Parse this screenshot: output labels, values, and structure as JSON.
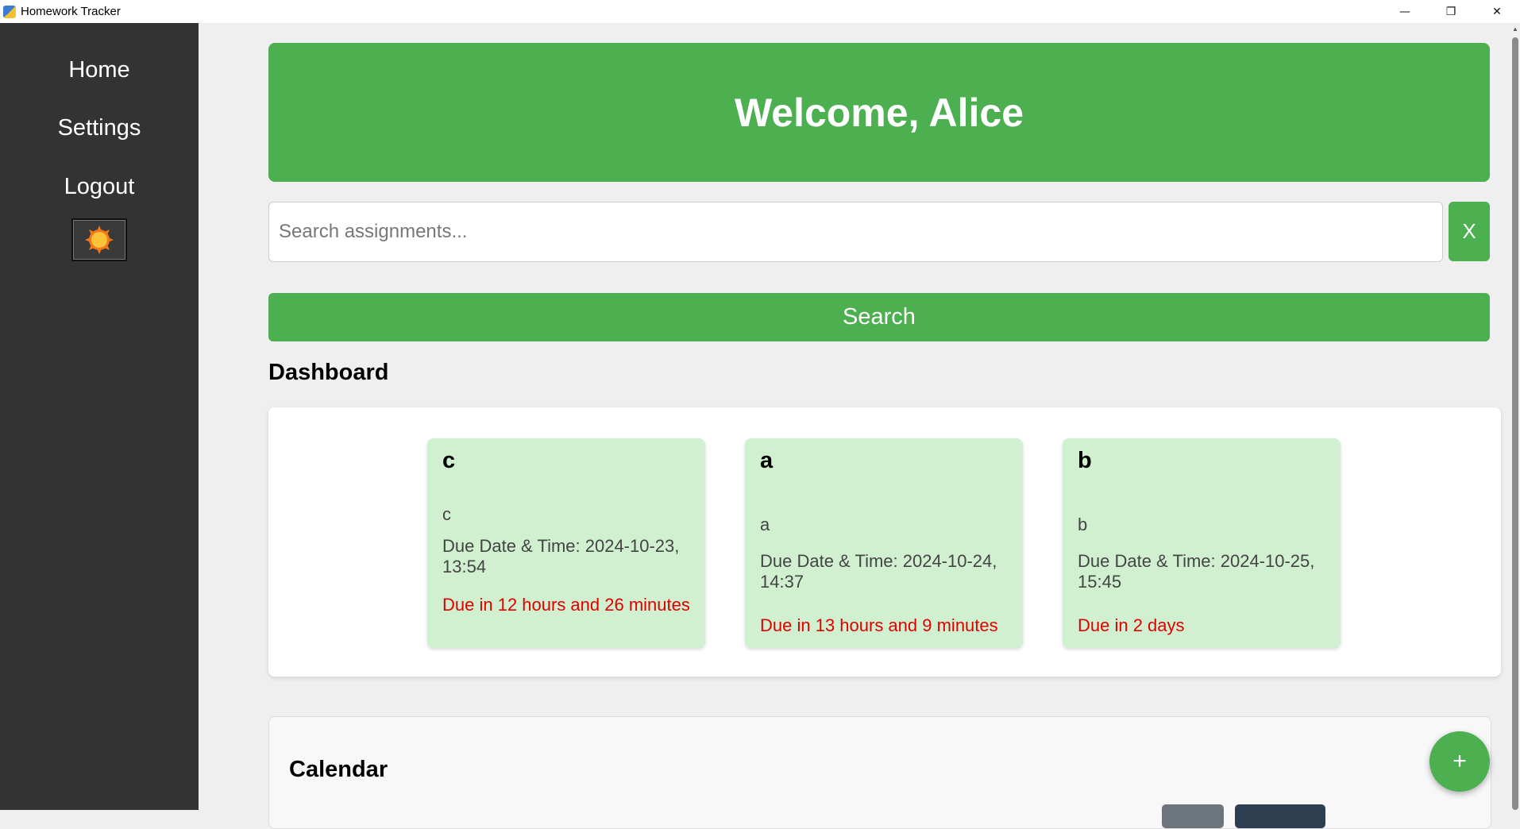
{
  "window": {
    "title": "Homework Tracker",
    "minimize_glyph": "—",
    "maximize_glyph": "❐",
    "close_glyph": "✕"
  },
  "sidebar": {
    "items": [
      {
        "label": "Home"
      },
      {
        "label": "Settings"
      },
      {
        "label": "Logout"
      }
    ],
    "theme_toggle_icon": "sun-icon"
  },
  "header": {
    "title": "Welcome, Alice"
  },
  "search": {
    "placeholder": "Search assignments...",
    "value": "",
    "clear_label": "X",
    "button_label": "Search"
  },
  "dashboard": {
    "title": "Dashboard",
    "cards": [
      {
        "title": "c",
        "description": "c",
        "due": "Due Date & Time: 2024-10-23, 13:54",
        "relative": "Due in 12 hours and 26 minutes"
      },
      {
        "title": "a",
        "description": "a",
        "due": "Due Date & Time: 2024-10-24, 14:37",
        "relative": "Due in 13 hours and 9 minutes"
      },
      {
        "title": "b",
        "description": "b",
        "due": "Due Date & Time: 2024-10-25, 15:45",
        "relative": "Due in 2 days"
      }
    ]
  },
  "calendar": {
    "title": "Calendar"
  },
  "fab": {
    "label": "+"
  },
  "colors": {
    "accent": "#4caf50",
    "sidebar": "#333333",
    "card_bg": "#d0f0d0",
    "due_warning": "#e00000"
  }
}
